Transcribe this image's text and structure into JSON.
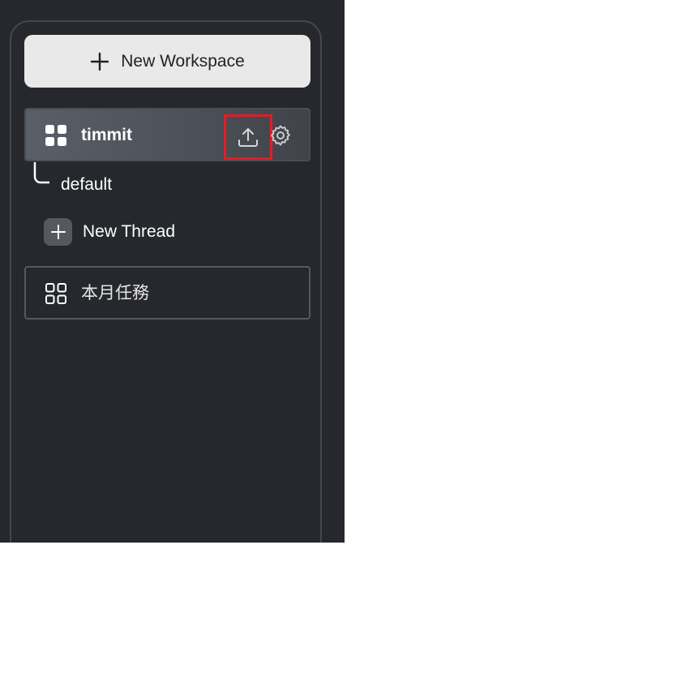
{
  "sidebar": {
    "new_workspace_label": "New Workspace",
    "workspaces": [
      {
        "name": "timmit",
        "active": true,
        "threads": [
          {
            "label": "default"
          }
        ],
        "new_thread_label": "New Thread"
      },
      {
        "name": "本月任務",
        "active": false
      }
    ]
  },
  "icons": {
    "plus": "plus-icon",
    "grid": "grid-icon",
    "upload": "upload-icon",
    "gear": "gear-icon"
  },
  "colors": {
    "panel_bg": "#26282d",
    "button_bg": "#e8e9e8",
    "highlight_border": "#e01e26",
    "active_item_bg": "#53575f"
  }
}
